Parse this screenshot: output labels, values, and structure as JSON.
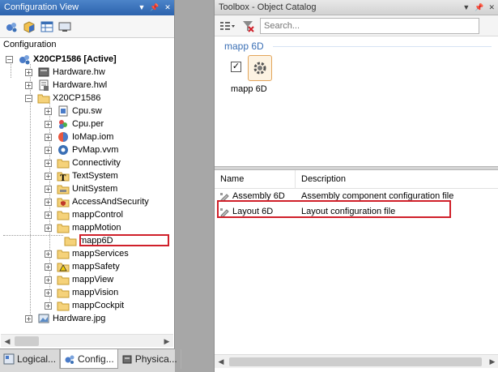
{
  "config_view": {
    "title": "Configuration View",
    "section_label": "Configuration",
    "tree": [
      {
        "label": "X20CP1586 [Active]",
        "icon": "cpu-config-icon"
      },
      {
        "label": "Hardware.hw",
        "icon": "hardware-icon"
      },
      {
        "label": "Hardware.hwl",
        "icon": "hardware-list-icon"
      },
      {
        "label": "X20CP1586",
        "icon": "folder-open-icon"
      },
      {
        "label": "Cpu.sw",
        "icon": "software-icon"
      },
      {
        "label": "Cpu.per",
        "icon": "permanent-memory-icon"
      },
      {
        "label": "IoMap.iom",
        "icon": "iomap-icon"
      },
      {
        "label": "PvMap.vvm",
        "icon": "pvmap-icon"
      },
      {
        "label": "Connectivity",
        "icon": "folder-icon"
      },
      {
        "label": "TextSystem",
        "icon": "text-system-icon"
      },
      {
        "label": "UnitSystem",
        "icon": "unit-system-icon"
      },
      {
        "label": "AccessAndSecurity",
        "icon": "security-icon"
      },
      {
        "label": "mappControl",
        "icon": "folder-icon"
      },
      {
        "label": "mappMotion",
        "icon": "folder-icon"
      },
      {
        "label": "mapp6D",
        "icon": "folder-icon"
      },
      {
        "label": "mappServices",
        "icon": "folder-icon"
      },
      {
        "label": "mappSafety",
        "icon": "safety-folder-icon"
      },
      {
        "label": "mappView",
        "icon": "folder-icon"
      },
      {
        "label": "mappVision",
        "icon": "folder-icon"
      },
      {
        "label": "mappCockpit",
        "icon": "folder-icon"
      },
      {
        "label": "Hardware.jpg",
        "icon": "image-icon"
      }
    ],
    "tabs": [
      {
        "label": "Logical...",
        "icon": "logical-view-icon"
      },
      {
        "label": "Config...",
        "icon": "configuration-view-icon"
      },
      {
        "label": "Physica...",
        "icon": "physical-view-icon"
      }
    ]
  },
  "toolbox": {
    "title": "Toolbox - Object Catalog",
    "search_placeholder": "Search...",
    "group_label": "mapp 6D",
    "item_label": "mapp 6D",
    "table": {
      "columns": [
        "Name",
        "Description"
      ],
      "rows": [
        {
          "name": "Assembly 6D",
          "description": "Assembly component configuration file"
        },
        {
          "name": "Layout 6D",
          "description": "Layout configuration file"
        }
      ]
    }
  },
  "colors": {
    "title_blue": "#2c63ad",
    "highlight_red": "#d0202a",
    "group_blue": "#3a6fb5"
  }
}
